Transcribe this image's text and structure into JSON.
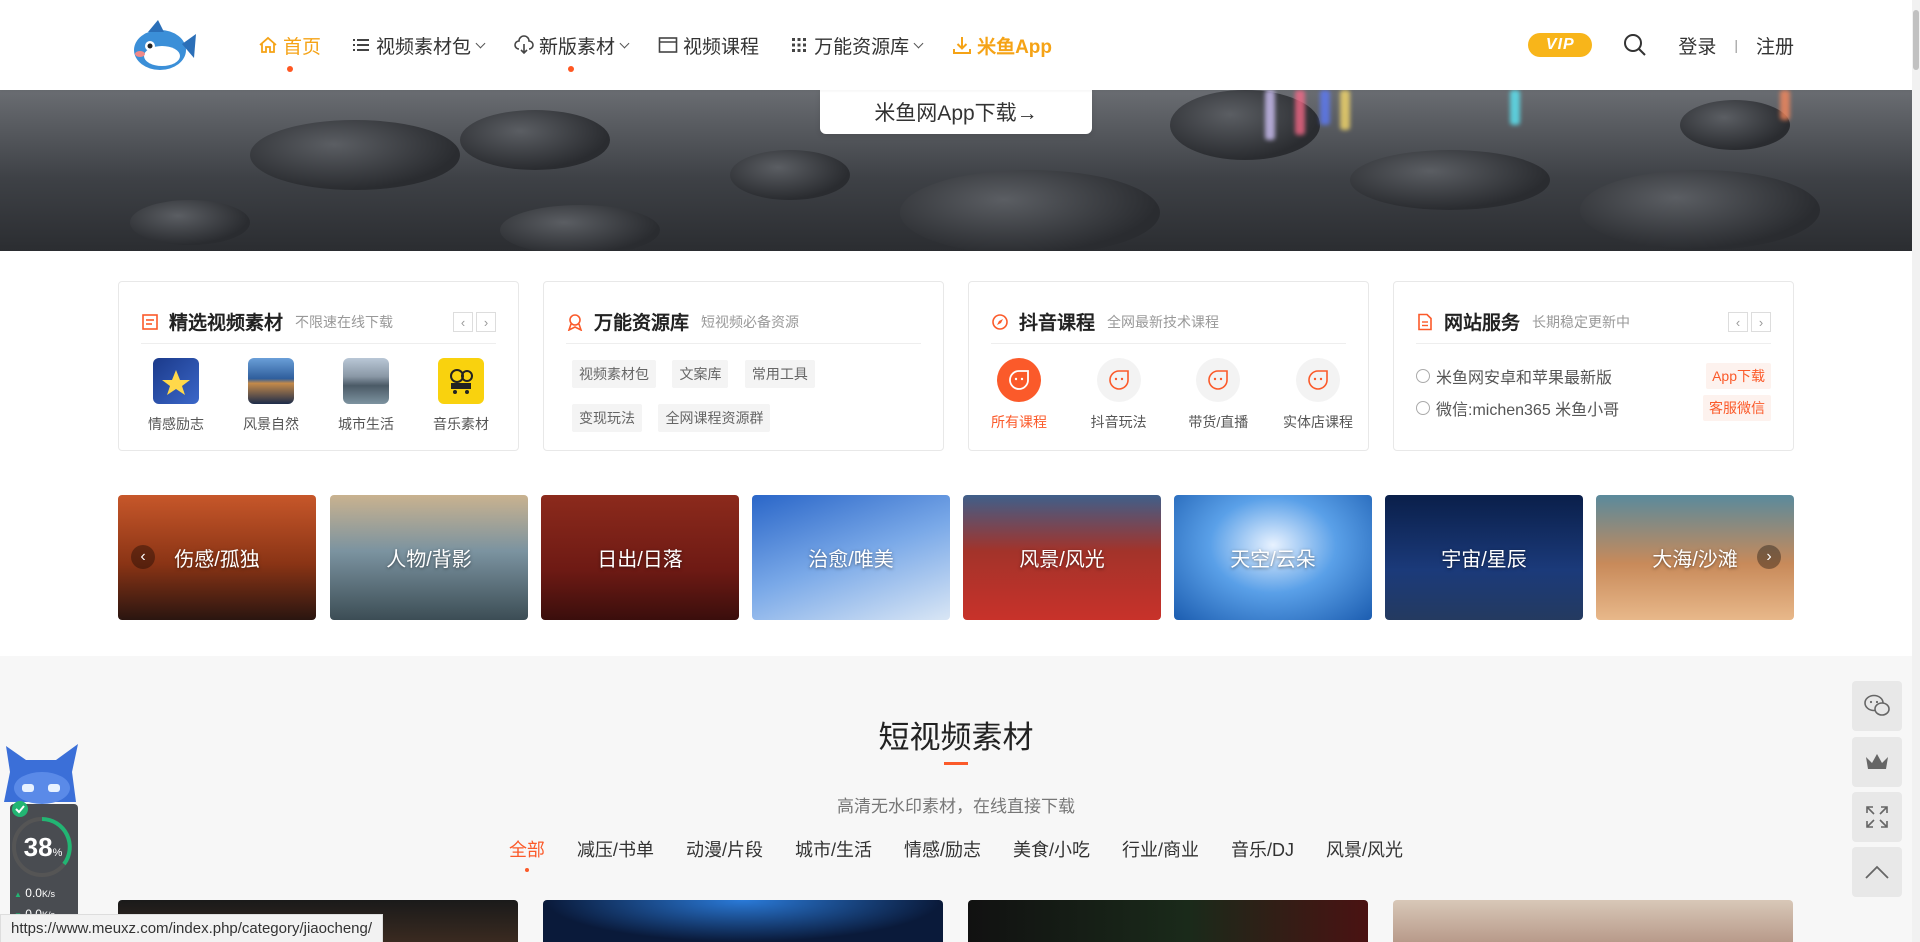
{
  "nav": {
    "home": "首页",
    "video_pack": "视频素材包",
    "new_material": "新版素材",
    "video_course": "视频课程",
    "resource_lib": "万能资源库",
    "app": "米鱼App"
  },
  "header_right": {
    "vip": "VIP",
    "login": "登录",
    "separator": "|",
    "register": "注册"
  },
  "banner": {
    "app_download": "米鱼网App下载→"
  },
  "cards": {
    "featured": {
      "title": "精选视频素材",
      "subtitle": "不限速在线下载",
      "items": [
        "情感励志",
        "风景自然",
        "城市生活",
        "音乐素材"
      ]
    },
    "resources": {
      "title": "万能资源库",
      "subtitle": "短视频必备资源",
      "tags": [
        "视频素材包",
        "文案库",
        "常用工具",
        "变现玩法",
        "全网课程资源群"
      ]
    },
    "douyin": {
      "title": "抖音课程",
      "subtitle": "全网最新技术课程",
      "items": [
        "所有课程",
        "抖音玩法",
        "带货/直播",
        "实体店课程"
      ]
    },
    "service": {
      "title": "网站服务",
      "subtitle": "长期稳定更新中",
      "rows": [
        {
          "text": "米鱼网安卓和苹果最新版",
          "button": "App下载"
        },
        {
          "text": "微信:michen365 米鱼小哥",
          "button": "客服微信"
        }
      ]
    }
  },
  "categories": [
    "伤感/孤独",
    "人物/背影",
    "日出/日落",
    "治愈/唯美",
    "风景/风光",
    "天空/云朵",
    "宇宙/星辰",
    "大海/沙滩"
  ],
  "section": {
    "title": "短视频素材",
    "subtitle": "高清无水印素材，在线直接下载",
    "filters": [
      "全部",
      "减压/书单",
      "动漫/片段",
      "城市/生活",
      "情感/励志",
      "美食/小吃",
      "行业/商业",
      "音乐/DJ",
      "风景/风光"
    ]
  },
  "widget": {
    "percent": "38",
    "percent_unit": "%",
    "up_speed": "0.0",
    "down_speed": "0.0",
    "speed_unit": "K/s"
  },
  "status_url": "https://www.meuxz.com/index.php/category/jiaocheng/",
  "colors": {
    "accent": "#fb5a2a",
    "nav_active": "#f5a316",
    "vip": "#f8b51a"
  }
}
